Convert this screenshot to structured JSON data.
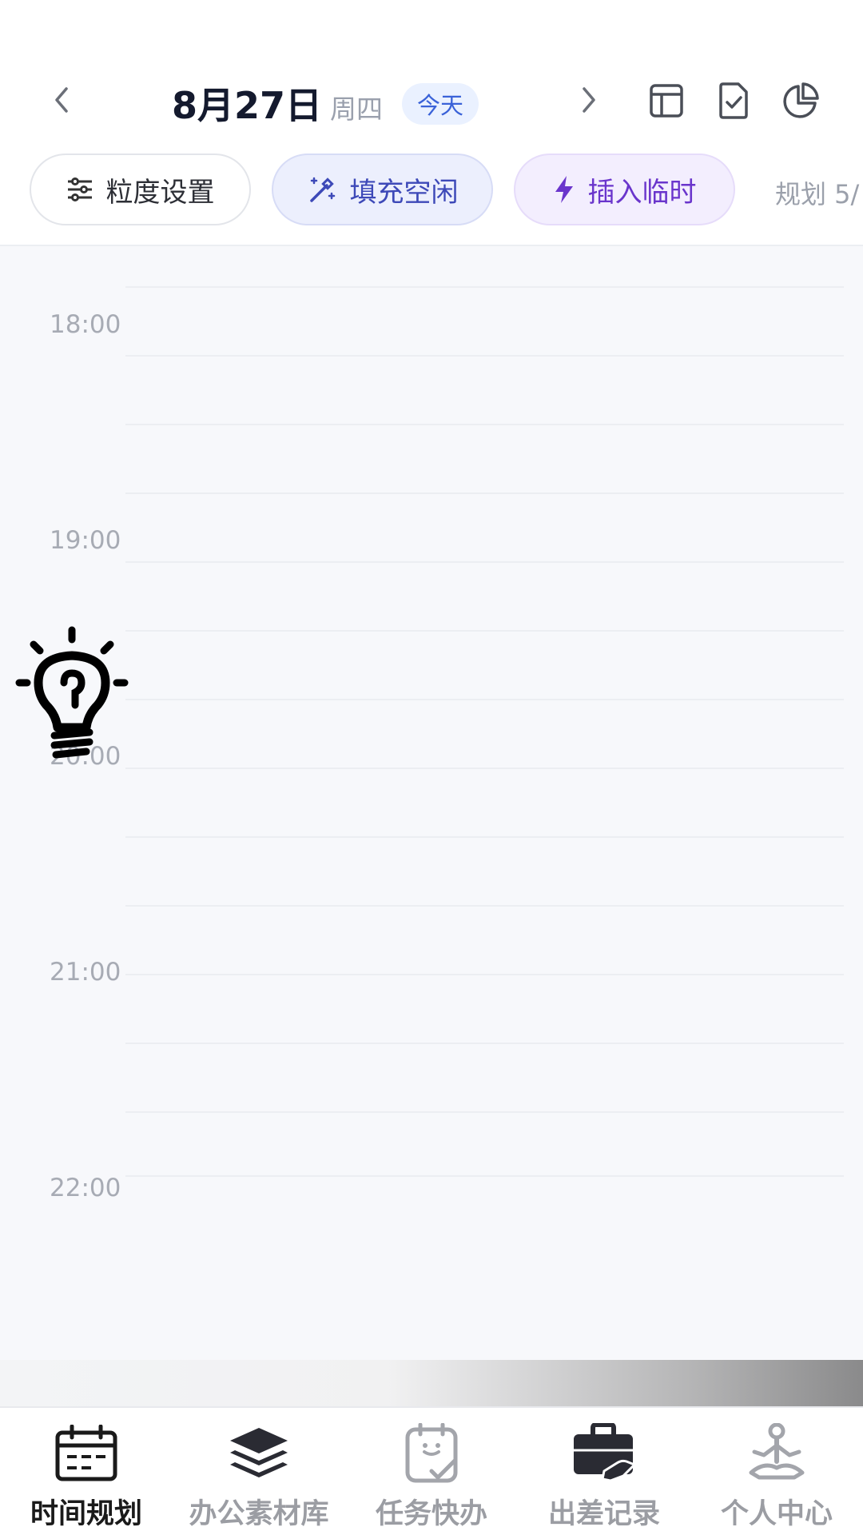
{
  "header": {
    "date": "8月27日",
    "weekday": "周四",
    "today_label": "今天",
    "icons": [
      "chevron-left-icon",
      "chevron-right-icon",
      "layout-icon",
      "document-check-icon",
      "pie-chart-icon"
    ]
  },
  "toolbar": {
    "granularity_label": "粒度设置",
    "fill_label": "填充空闲",
    "insert_label": "插入临时",
    "plan_text": "规划 5/"
  },
  "timeline": {
    "hours": [
      "18:00",
      "19:00",
      "20:00",
      "21:00",
      "22:00"
    ],
    "tip_icon": "lightbulb-icon"
  },
  "tabbar": {
    "items": [
      {
        "label": "时间规划",
        "icon": "calendar-icon",
        "active": true
      },
      {
        "label": "办公素材库",
        "icon": "layers-icon",
        "active": false
      },
      {
        "label": "任务快办",
        "icon": "clipboard-check-icon",
        "active": false
      },
      {
        "label": "出差记录",
        "icon": "briefcase-icon",
        "active": false
      },
      {
        "label": "个人中心",
        "icon": "meditation-icon",
        "active": false
      }
    ]
  },
  "colors": {
    "accent_blue": "#3a62d8",
    "accent_indigo": "#3d49b8",
    "accent_purple": "#6a35cc",
    "text_dark": "#141a2e",
    "text_muted": "#9aa0ad"
  }
}
